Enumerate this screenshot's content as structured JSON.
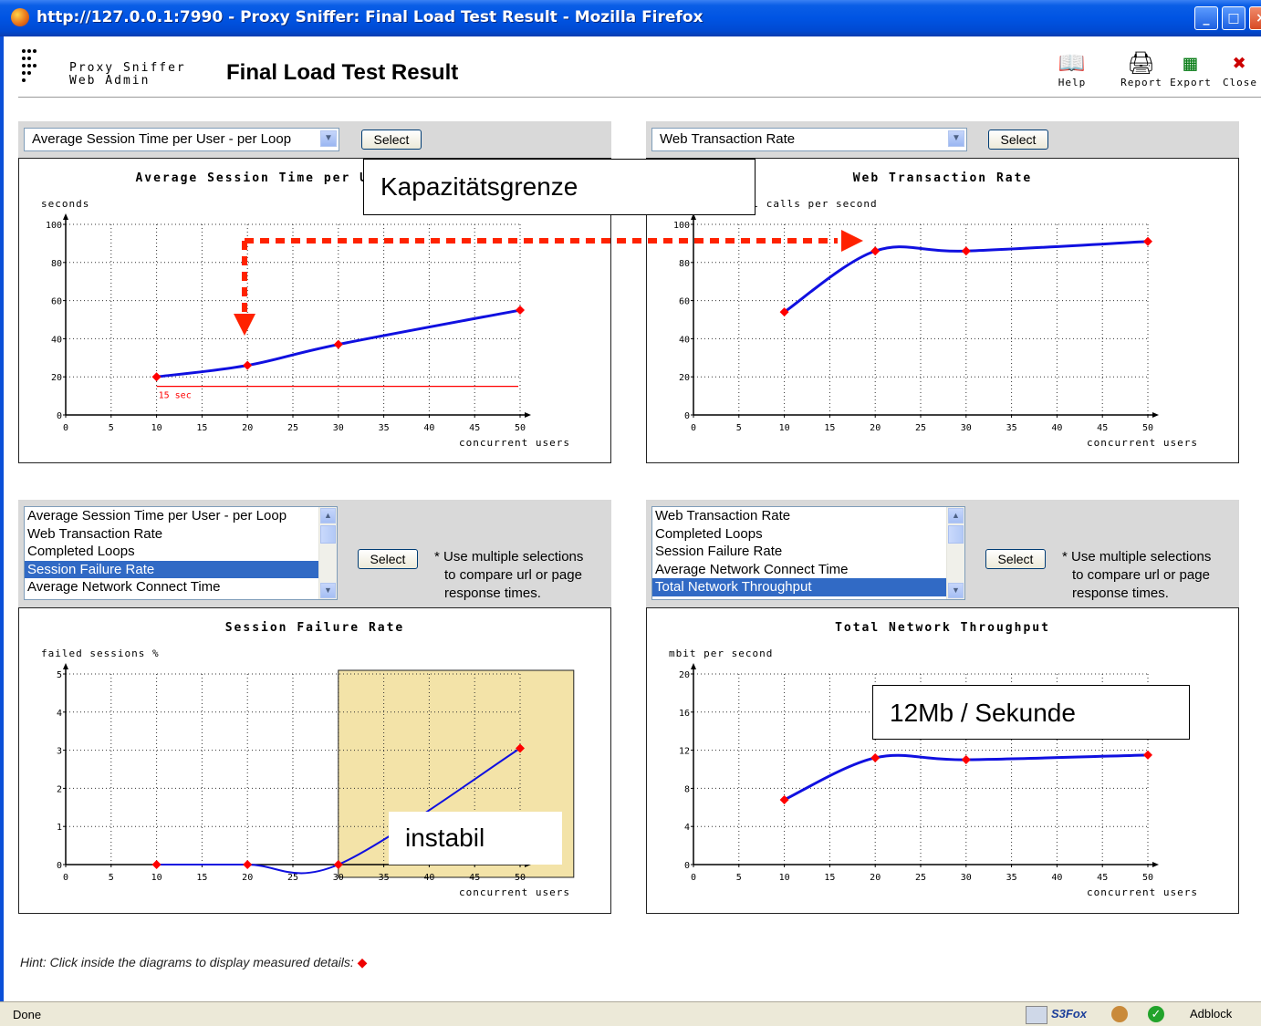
{
  "window": {
    "title": "http://127.0.0.1:7990 - Proxy Sniffer: Final Load Test Result - Mozilla Firefox"
  },
  "header": {
    "app_name_line1": "Proxy Sniffer",
    "app_name_line2": "Web Admin",
    "page_title": "Final Load Test Result",
    "tools": [
      {
        "label": "Help",
        "icon": "book-icon"
      },
      {
        "label": "Report",
        "icon": "printer-icon"
      },
      {
        "label": "Export",
        "icon": "spreadsheet-icon"
      },
      {
        "label": "Close",
        "icon": "close-x-icon"
      }
    ]
  },
  "panels": {
    "top_left": {
      "select_value": "Average Session Time per User - per Loop",
      "button": "Select"
    },
    "top_right": {
      "select_value": "Web Transaction Rate",
      "button": "Select"
    },
    "bottom_left": {
      "list": [
        "Average Session Time per User - per Loop",
        "Web Transaction Rate",
        "Completed Loops",
        "Session Failure Rate",
        "Average Network Connect Time"
      ],
      "selected": "Session Failure Rate",
      "button": "Select",
      "note": [
        "* Use multiple selections",
        "to compare url or page",
        "response times."
      ]
    },
    "bottom_right": {
      "list": [
        "Web Transaction Rate",
        "Completed Loops",
        "Session Failure Rate",
        "Average Network Connect Time",
        "Total Network Throughput"
      ],
      "selected": "Total Network Throughput",
      "button": "Select",
      "note": [
        "* Use multiple selections",
        "to compare url or page",
        "response times."
      ]
    }
  },
  "chart_data": [
    {
      "type": "line",
      "title": "Average Session Time per User - per Loop",
      "ylabel": "seconds",
      "xlabel": "concurrent users",
      "x_ticks": [
        0,
        5,
        10,
        15,
        20,
        25,
        30,
        35,
        40,
        45,
        50
      ],
      "y_ticks": [
        0,
        20,
        40,
        60,
        80,
        100
      ],
      "xlim": [
        0,
        50
      ],
      "ylim": [
        0,
        100
      ],
      "x": [
        10,
        20,
        30,
        50
      ],
      "values": [
        20,
        26,
        37,
        55
      ],
      "threshold": {
        "value": 15,
        "label": "15 sec",
        "color": "#ff0000"
      }
    },
    {
      "type": "line",
      "title": "Web Transaction Rate",
      "ylabel": "completed url calls per second",
      "xlabel": "concurrent users",
      "x_ticks": [
        0,
        5,
        10,
        15,
        20,
        25,
        30,
        35,
        40,
        45,
        50
      ],
      "y_ticks": [
        0,
        20,
        40,
        60,
        80,
        100
      ],
      "xlim": [
        0,
        50
      ],
      "ylim": [
        0,
        100
      ],
      "x": [
        10,
        20,
        30,
        50
      ],
      "values": [
        54,
        86,
        86,
        91
      ]
    },
    {
      "type": "line",
      "title": "Session Failure Rate",
      "ylabel": "failed sessions %",
      "xlabel": "concurrent users",
      "x_ticks": [
        0,
        5,
        10,
        15,
        20,
        25,
        30,
        35,
        40,
        45,
        50
      ],
      "y_ticks": [
        0,
        1,
        2,
        3,
        4,
        5
      ],
      "xlim": [
        0,
        50
      ],
      "ylim": [
        0,
        5
      ],
      "x": [
        10,
        20,
        30,
        50
      ],
      "values": [
        0,
        0,
        0,
        3.05
      ]
    },
    {
      "type": "line",
      "title": "Total Network Throughput",
      "ylabel": "mbit per second",
      "xlabel": "concurrent users",
      "x_ticks": [
        0,
        5,
        10,
        15,
        20,
        25,
        30,
        35,
        40,
        45,
        50
      ],
      "y_ticks": [
        0,
        4,
        8,
        12,
        16,
        20
      ],
      "xlim": [
        0,
        50
      ],
      "ylim": [
        0,
        20
      ],
      "x": [
        10,
        20,
        30,
        50
      ],
      "values": [
        6.8,
        11.2,
        11.0,
        11.5
      ]
    }
  ],
  "annotations": {
    "capacity": "Kapazitätsgrenze",
    "unstable": "instabil",
    "throughput": "12Mb / Sekunde"
  },
  "colors": {
    "line": "#1010e0",
    "marker": "#ff0000",
    "highlight": "#f3e3a8"
  },
  "hint": "Hint: Click inside the diagrams to display measured details:",
  "statusbar": {
    "status": "Done",
    "addons": [
      "S3Fox",
      "Adblock"
    ]
  }
}
